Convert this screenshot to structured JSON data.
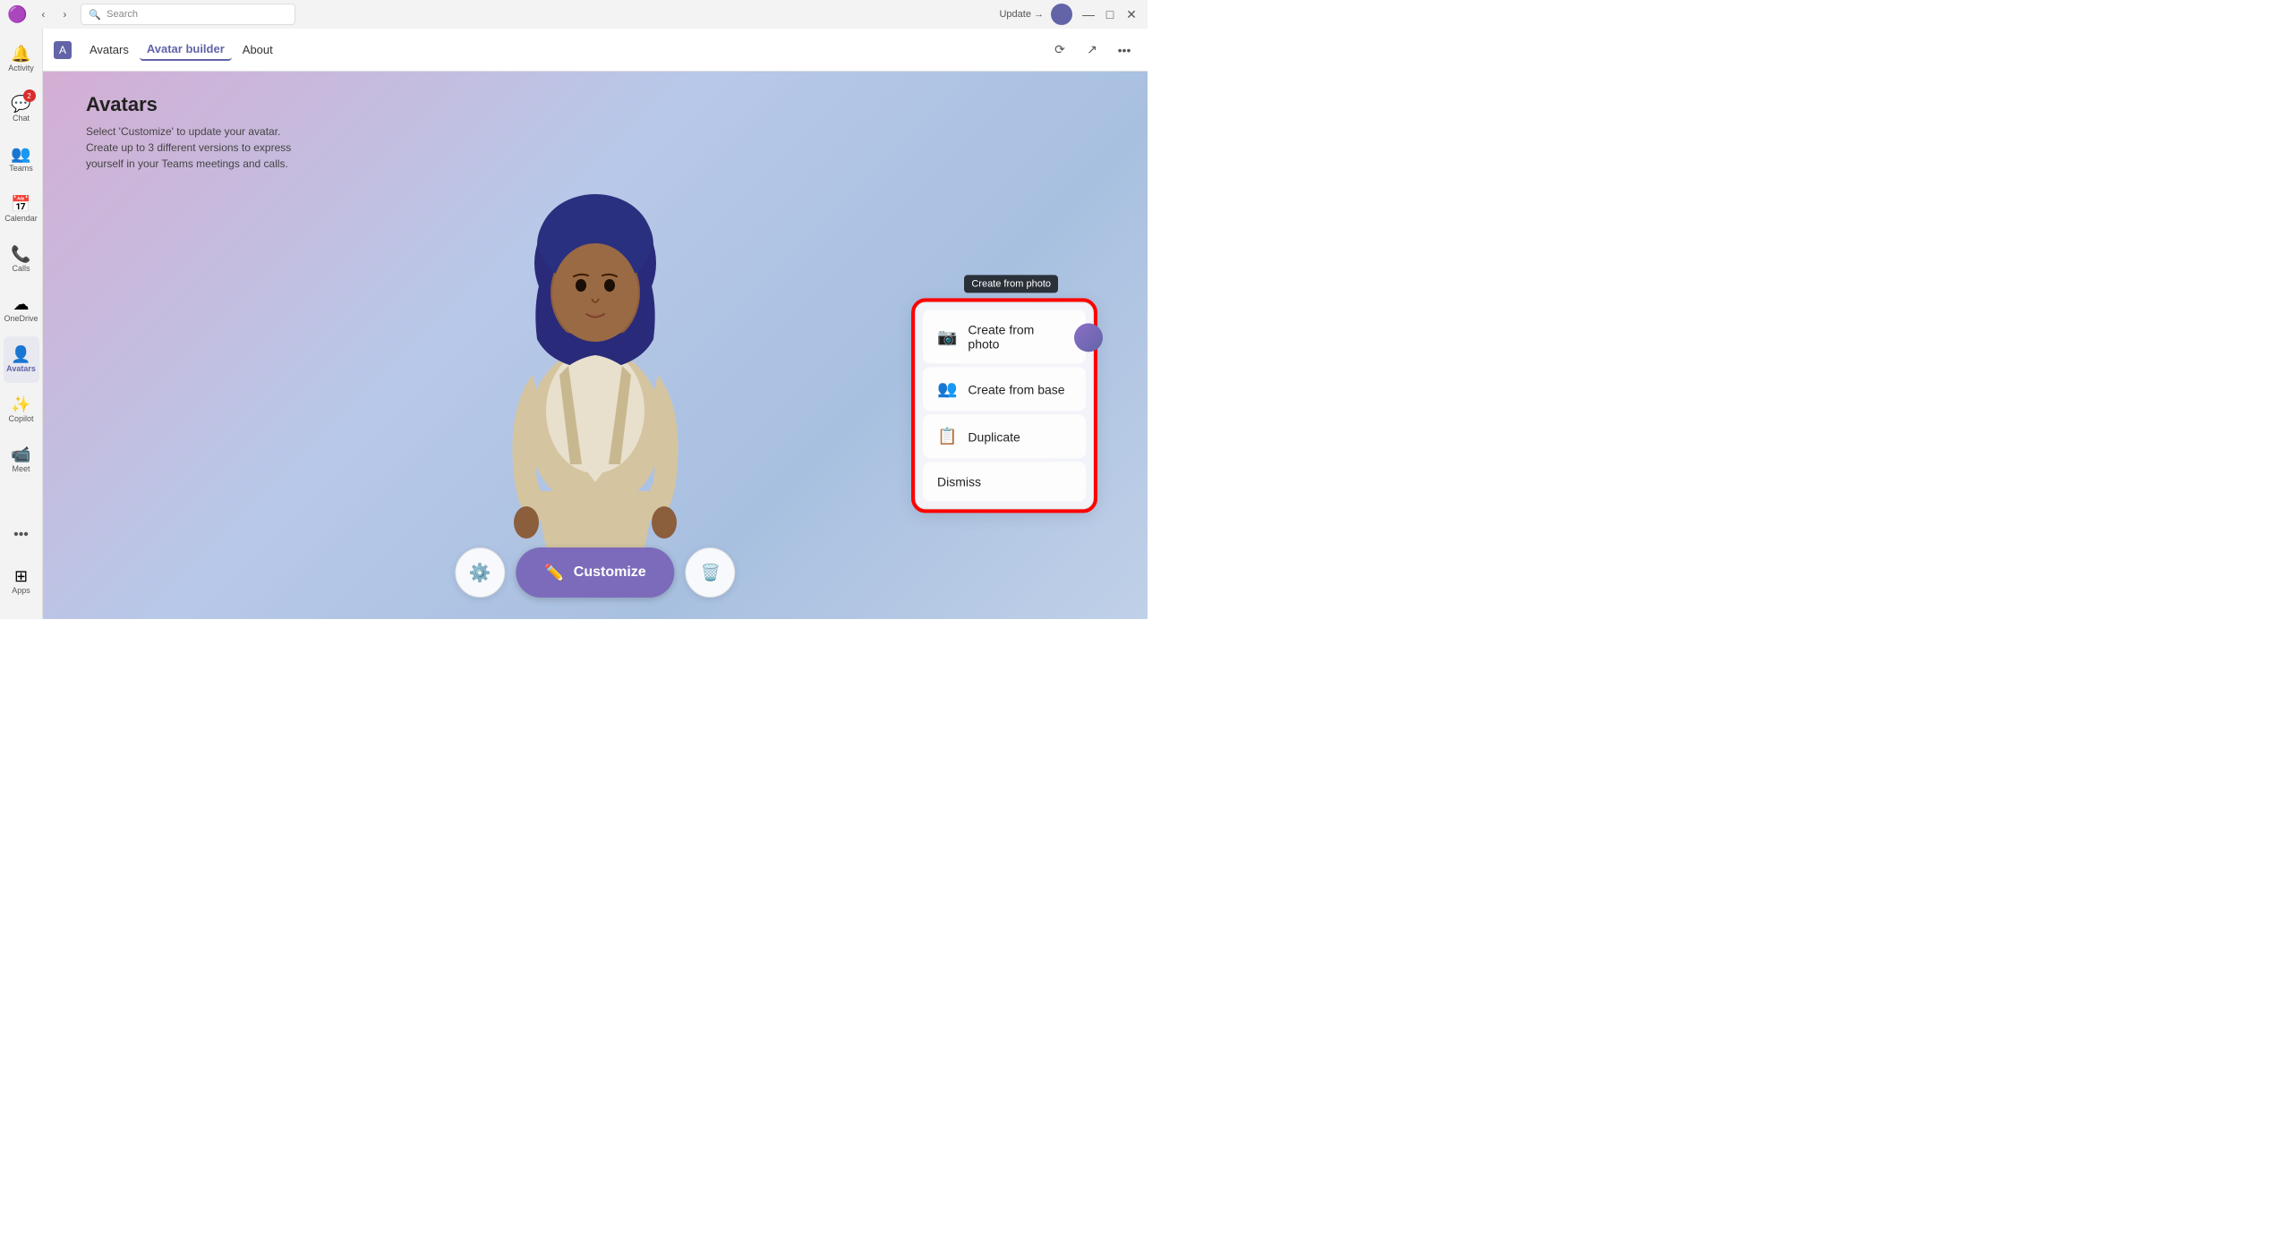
{
  "titleBar": {
    "searchPlaceholder": "Search",
    "updateLabel": "Update →",
    "navBack": "‹",
    "navForward": "›",
    "windowControls": [
      "—",
      "□",
      "✕"
    ]
  },
  "sidebar": {
    "items": [
      {
        "id": "activity",
        "label": "Activity",
        "icon": "🔔",
        "badge": null
      },
      {
        "id": "chat",
        "label": "Chat",
        "icon": "💬",
        "badge": "2"
      },
      {
        "id": "teams",
        "label": "Teams",
        "icon": "👥",
        "badge": null
      },
      {
        "id": "calendar",
        "label": "Calendar",
        "icon": "📅",
        "badge": null
      },
      {
        "id": "calls",
        "label": "Calls",
        "icon": "📞",
        "badge": null
      },
      {
        "id": "onedrive",
        "label": "OneDrive",
        "icon": "☁",
        "badge": null
      },
      {
        "id": "avatars",
        "label": "Avatars",
        "icon": "👤",
        "badge": null,
        "active": true
      },
      {
        "id": "copilot",
        "label": "Copilot",
        "icon": "✨",
        "badge": null
      },
      {
        "id": "meet",
        "label": "Meet",
        "icon": "📹",
        "badge": null
      }
    ],
    "dotsLabel": "•••",
    "appsLabel": "Apps"
  },
  "appHeader": {
    "logoText": "A",
    "nav": [
      {
        "id": "avatars",
        "label": "Avatars",
        "active": false
      },
      {
        "id": "avatar-builder",
        "label": "Avatar builder",
        "active": true
      },
      {
        "id": "about",
        "label": "About",
        "active": false
      }
    ]
  },
  "page": {
    "title": "Avatars",
    "subtitle": "Select 'Customize' to update your avatar. Create up to 3 different versions to express yourself in your Teams meetings and calls."
  },
  "bottomControls": {
    "settingsIcon": "⚙",
    "customizeLabel": "Customize",
    "customizeIcon": "✏",
    "deleteIcon": "🗑"
  },
  "dropdown": {
    "tooltipLabel": "Create from photo",
    "items": [
      {
        "id": "create-from-photo",
        "label": "Create from photo",
        "icon": "📷"
      },
      {
        "id": "create-from-base",
        "label": "Create from base",
        "icon": "👥"
      },
      {
        "id": "duplicate",
        "label": "Duplicate",
        "icon": "📋"
      },
      {
        "id": "dismiss",
        "label": "Dismiss",
        "icon": ""
      }
    ]
  }
}
